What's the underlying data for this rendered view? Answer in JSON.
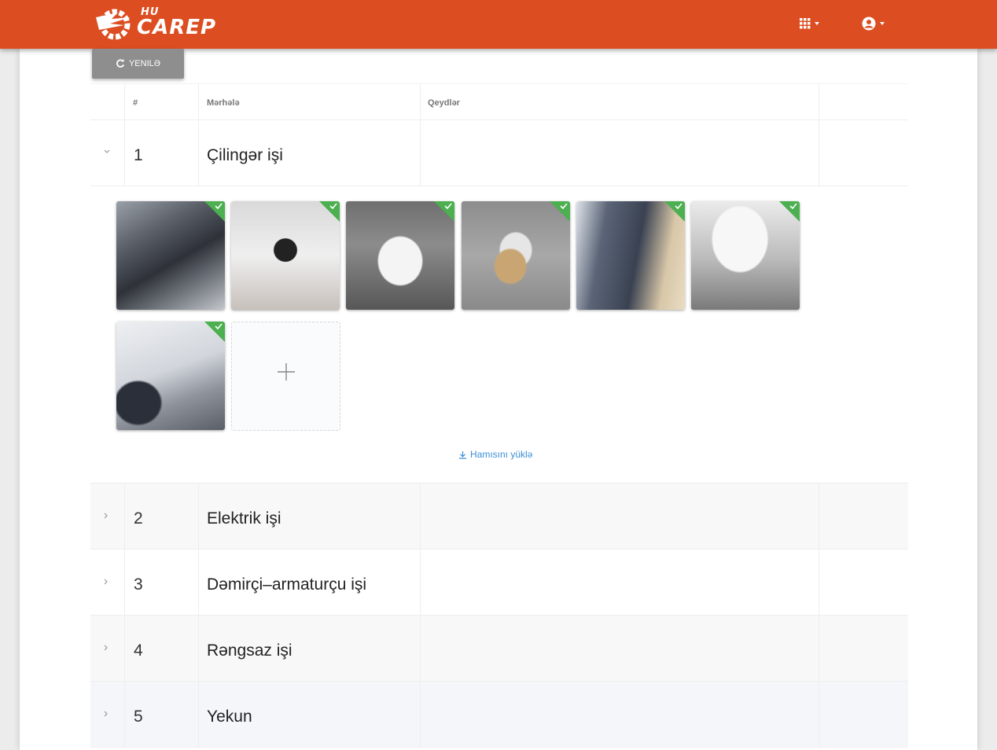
{
  "header": {
    "logo_small": "HU",
    "logo_big": "CAREP",
    "apps_icon": "grid-icon",
    "user_icon": "user-circle-icon",
    "color": "#dc4e21"
  },
  "toolbar": {
    "refresh_label": "YENILƏ",
    "refresh_icon": "refresh-icon"
  },
  "table": {
    "columns": [
      "",
      "#",
      "Mərhələ",
      "Qeydlər",
      ""
    ],
    "rows": [
      {
        "num": "1",
        "name": "Çilingər işi",
        "expanded": true
      },
      {
        "num": "2",
        "name": "Elektrik işi",
        "expanded": false
      },
      {
        "num": "3",
        "name": "Dəmirçi–armaturçu işi",
        "expanded": false
      },
      {
        "num": "4",
        "name": "Rəngsaz işi",
        "expanded": false
      },
      {
        "num": "5",
        "name": "Yekun",
        "expanded": false
      }
    ]
  },
  "gallery": {
    "photos": [
      {
        "subject": "damaged-front-bumper",
        "approved": true
      },
      {
        "subject": "black-part-held",
        "approved": true
      },
      {
        "subject": "white-sedan-rear",
        "approved": true
      },
      {
        "subject": "parts-on-box",
        "approved": true
      },
      {
        "subject": "bumper-inside",
        "approved": true
      },
      {
        "subject": "white-car-front",
        "approved": true
      },
      {
        "subject": "headlight-closeup",
        "approved": true
      }
    ],
    "add_icon": "plus-icon",
    "download_label": "Hamısını yüklə",
    "download_icon": "download-icon",
    "approved_color": "#4caf50"
  }
}
